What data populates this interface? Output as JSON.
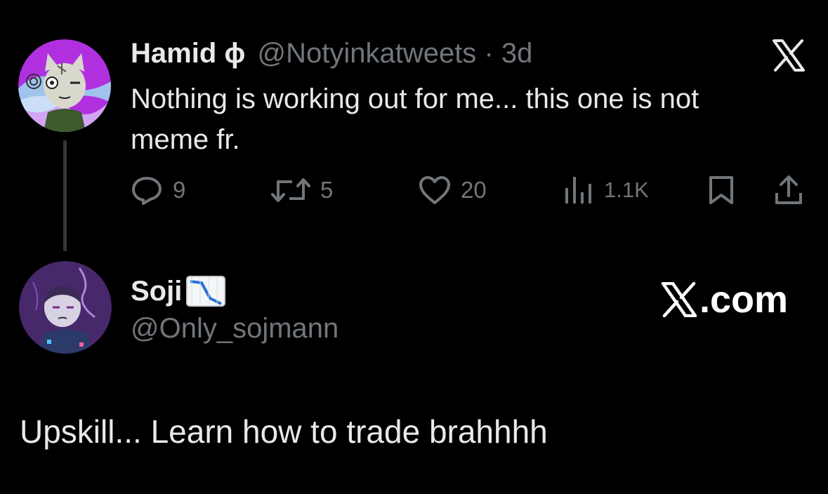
{
  "tweet": {
    "author_name": "Hamid ɸ",
    "handle": "@Notyinkatweets",
    "separator": "·",
    "time": "3d",
    "text": "Nothing is working out for me... this one is not meme fr.",
    "platform_icon": "x-logo-icon",
    "actions": {
      "replies": "9",
      "reposts": "5",
      "likes": "20",
      "views": "1.1K"
    }
  },
  "reply": {
    "author_name": "Soji",
    "name_emoji": "chart-decreasing-icon",
    "handle": "@Only_sojmann",
    "text": "Upskill... Learn how to trade brahhhh"
  },
  "watermark": {
    "text": ".com",
    "icon": "x-logo-icon"
  },
  "colors": {
    "background": "#000000",
    "text": "#e7e9ea",
    "muted": "#71767b",
    "thread_line": "#333639",
    "avatar1_accent": "#b030e0",
    "avatar2_accent": "#6a3fa0"
  }
}
